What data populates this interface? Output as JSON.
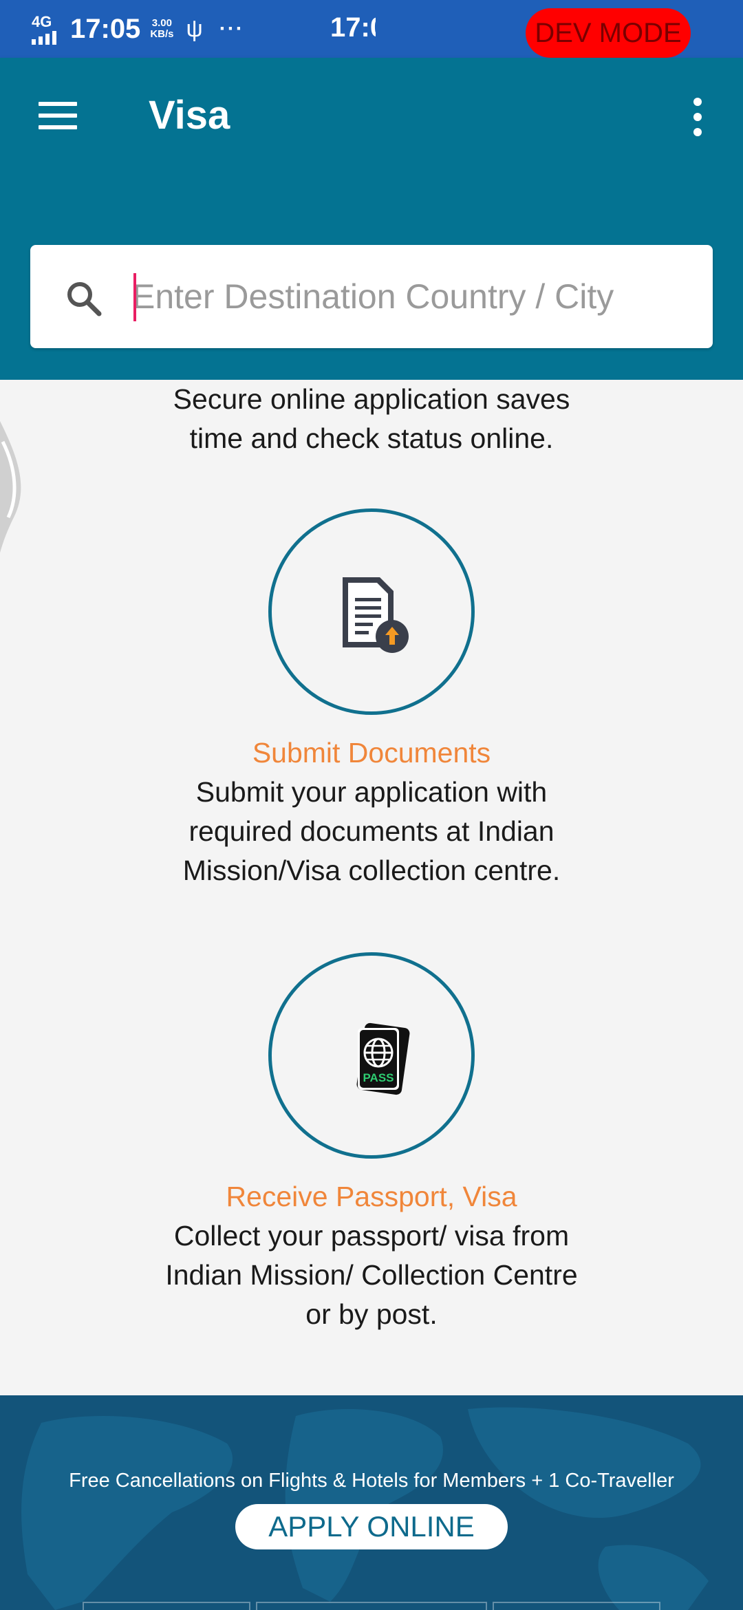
{
  "status_bar": {
    "network": "4G",
    "time": "17:05",
    "speed_value": "3.00",
    "speed_unit": "KB/s",
    "usb_icon": "usb-icon",
    "more": "···",
    "time_clipped": "17:0",
    "dev_mode": "DEV MODE"
  },
  "app_bar": {
    "title": "Visa",
    "menu_icon": "hamburger-icon",
    "overflow_icon": "more-vert-icon",
    "background": "#047392"
  },
  "search": {
    "placeholder": "Enter Destination Country / City",
    "icon": "search-icon"
  },
  "steps": [
    {
      "title": "",
      "description": "Secure online application saves time and check status online."
    },
    {
      "icon": "document-upload-icon",
      "title": "Submit Documents",
      "description": "Submit your application with required documents at Indian Mission/Visa collection centre."
    },
    {
      "icon": "passport-icon",
      "icon_text": "PASS",
      "title": "Receive Passport, Visa",
      "description": "Collect your passport/ visa from Indian Mission/ Collection Centre or by post."
    }
  ],
  "banner": {
    "text": "Free Cancellations on Flights & Hotels for Members + 1 Co-Traveller",
    "button": "APPLY ONLINE"
  },
  "colors": {
    "accent_orange": "#f0863a",
    "circle_border": "#10708e",
    "dev_mode_bg": "#ff0000",
    "status_bar_bg": "#1f5fb8"
  }
}
